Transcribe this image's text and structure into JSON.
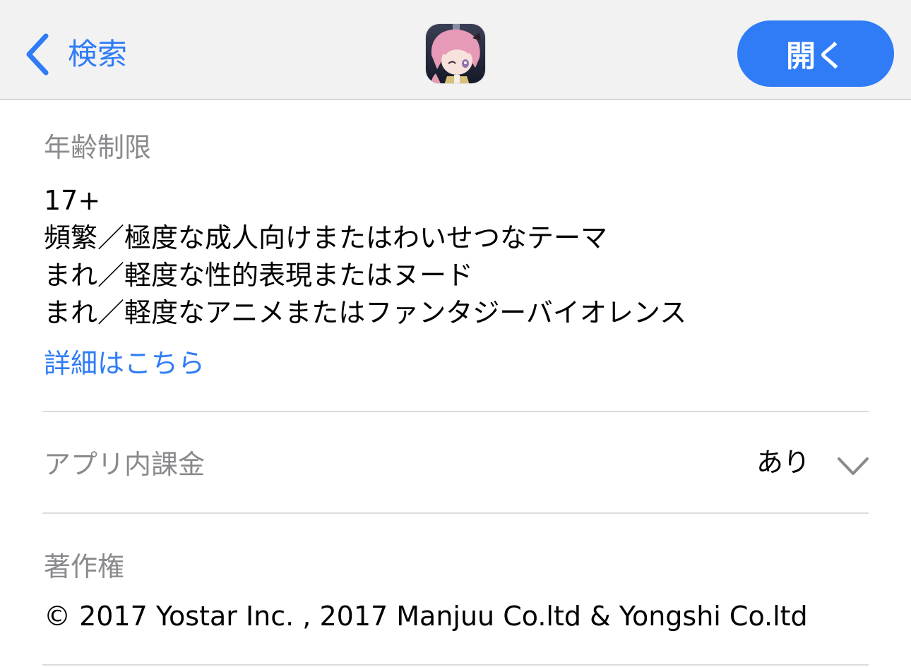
{
  "nav": {
    "back_label": "検索",
    "open_label": "開く"
  },
  "age_rating": {
    "title": "年齢制限",
    "lines": [
      "17+",
      "頻繁／極度な成人向けまたはわいせつなテーマ",
      "まれ／軽度な性的表現またはヌード",
      "まれ／軽度なアニメまたはファンタジーバイオレンス"
    ],
    "more_link": "詳細はこちら"
  },
  "in_app_purchases": {
    "title": "アプリ内課金",
    "value": "あり"
  },
  "copyright": {
    "title": "著作権",
    "text": "© 2017 Yostar Inc. , 2017 Manjuu Co.ltd & Yongshi Co.ltd"
  },
  "colors": {
    "accent": "#2f7cf6",
    "secondary_text": "#8a8a8e",
    "nav_background": "#f2f2f3",
    "divider": "#dcdcde"
  },
  "icons": {
    "back": "chevron-left-icon",
    "expand": "chevron-down-icon",
    "app": "app-icon"
  }
}
